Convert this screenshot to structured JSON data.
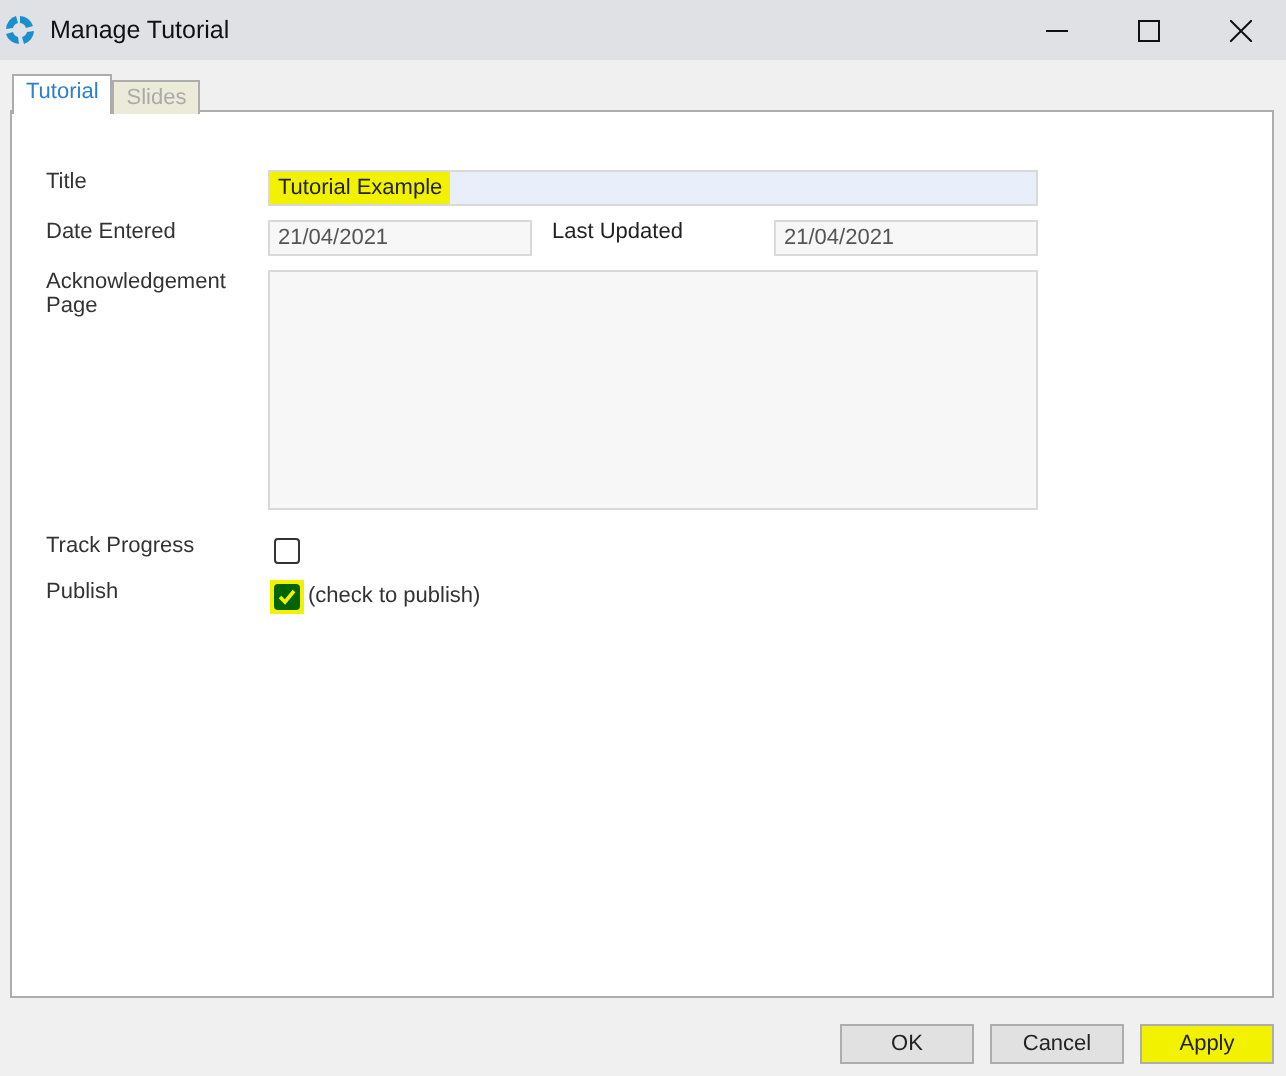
{
  "window": {
    "title": "Manage Tutorial"
  },
  "tabs": [
    {
      "label": "Tutorial",
      "selected": true
    },
    {
      "label": "Slides",
      "selected": false
    }
  ],
  "form": {
    "title": {
      "label": "Title",
      "value": "Tutorial Example",
      "highlighted": true
    },
    "date_entered": {
      "label": "Date Entered",
      "value": "21/04/2021"
    },
    "last_updated": {
      "label": "Last Updated",
      "value": "21/04/2021"
    },
    "acknowledgement_page": {
      "label": "Acknowledgement Page"
    },
    "track_progress": {
      "label": "Track Progress",
      "checked": false,
      "highlighted": false
    },
    "publish": {
      "label": "Publish",
      "checked": true,
      "highlighted": true,
      "hint": "(check to publish)"
    }
  },
  "buttons": [
    {
      "label": "OK",
      "highlighted": false
    },
    {
      "label": "Cancel",
      "highlighted": false
    },
    {
      "label": "Apply",
      "highlighted": true
    }
  ]
}
